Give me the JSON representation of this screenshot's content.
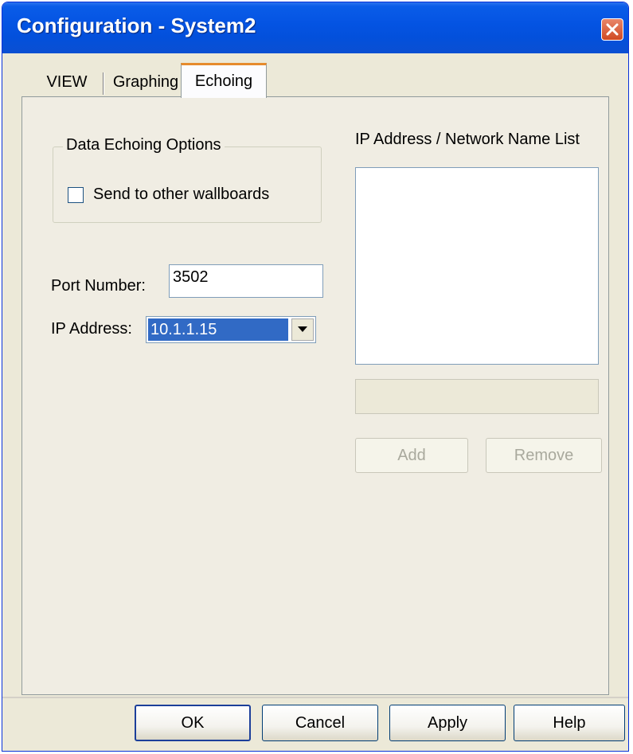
{
  "window": {
    "title": "Configuration - System2"
  },
  "tabs": [
    {
      "label": "VIEW",
      "active": false
    },
    {
      "label": "Graphing",
      "active": false
    },
    {
      "label": "Echoing",
      "active": true
    }
  ],
  "echoing": {
    "group_title": "Data Echoing Options",
    "send_checkbox": {
      "label": "Send to other wallboards",
      "checked": false
    },
    "port_label": "Port Number:",
    "port_value": "3502",
    "ip_label": "IP Address:",
    "ip_value": "10.1.1.15",
    "list_title": "IP Address / Network Name List",
    "list_items": [],
    "name_input_value": "",
    "add_label": "Add",
    "remove_label": "Remove"
  },
  "footer": {
    "ok_label": "OK",
    "cancel_label": "Cancel",
    "apply_label": "Apply",
    "help_label": "Help"
  },
  "colors": {
    "titlebar": "#0453e2",
    "dialog_bg": "#ece9d8",
    "selection": "#316ac5",
    "active_tab_accent": "#e68b2c",
    "close_button": "#d04922"
  },
  "icons": {
    "close": "close-icon",
    "dropdown": "chevron-down-icon"
  }
}
